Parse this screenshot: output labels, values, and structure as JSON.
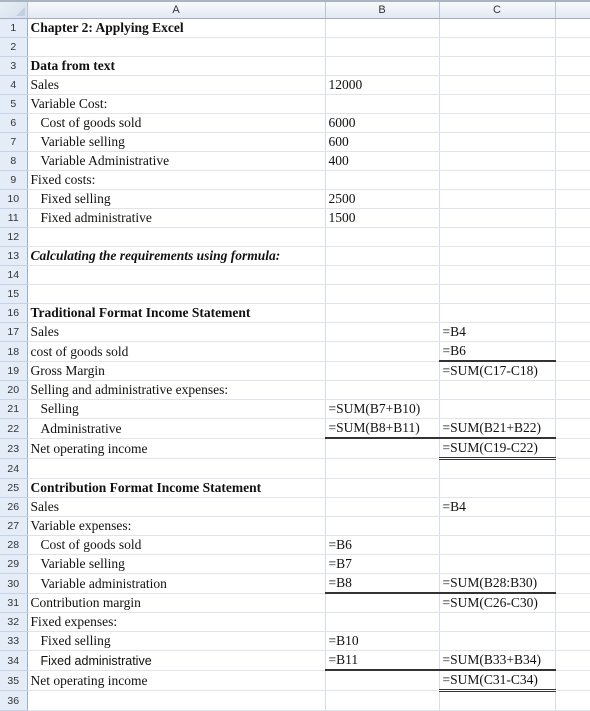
{
  "columns": [
    "A",
    "B",
    "C",
    ""
  ],
  "rows": [
    {
      "n": "1",
      "a": "Chapter 2: Applying Excel",
      "a_style": "bold",
      "b": "",
      "c": ""
    },
    {
      "n": "2",
      "a": "",
      "b": "",
      "c": ""
    },
    {
      "n": "3",
      "a": "Data from text",
      "a_style": "bold",
      "b": "",
      "c": ""
    },
    {
      "n": "4",
      "a": "Sales",
      "b": "12000",
      "c": ""
    },
    {
      "n": "5",
      "a": "Variable Cost:",
      "b": "",
      "c": ""
    },
    {
      "n": "6",
      "a": "Cost of goods sold",
      "a_style": "indent",
      "b": "6000",
      "c": ""
    },
    {
      "n": "7",
      "a": "Variable selling",
      "a_style": "indent",
      "b": "600",
      "c": ""
    },
    {
      "n": "8",
      "a": "Variable Administrative",
      "a_style": "indent",
      "b": "400",
      "c": ""
    },
    {
      "n": "9",
      "a": "Fixed costs:",
      "b": "",
      "c": ""
    },
    {
      "n": "10",
      "a": "Fixed selling",
      "a_style": "indent",
      "b": "2500",
      "c": ""
    },
    {
      "n": "11",
      "a": "Fixed administrative",
      "a_style": "indent",
      "b": "1500",
      "c": ""
    },
    {
      "n": "12",
      "a": "",
      "b": "",
      "c": ""
    },
    {
      "n": "13",
      "a": "Calculating the requirements using formula:",
      "a_style": "bolditalic",
      "b": "",
      "c": ""
    },
    {
      "n": "14",
      "a": "",
      "b": "",
      "c": ""
    },
    {
      "n": "15",
      "a": "",
      "b": "",
      "c": ""
    },
    {
      "n": "16",
      "a": "Traditional Format Income Statement",
      "a_style": "bold",
      "b": "",
      "c": ""
    },
    {
      "n": "17",
      "a": "Sales",
      "b": "",
      "c": "=B4"
    },
    {
      "n": "18",
      "a": "cost of goods sold",
      "b": "",
      "c": "=B6",
      "c_border": "single"
    },
    {
      "n": "19",
      "a": "Gross Margin",
      "b": "",
      "c": "=SUM(C17-C18)"
    },
    {
      "n": "20",
      "a": "Selling and administrative expenses:",
      "b": "",
      "c": ""
    },
    {
      "n": "21",
      "a": "Selling",
      "a_style": "indent",
      "b": "=SUM(B7+B10)",
      "c": ""
    },
    {
      "n": "22",
      "a": "Administrative",
      "a_style": "indent",
      "b": "=SUM(B8+B11)",
      "b_border": "single",
      "c": "=SUM(B21+B22)",
      "c_border": "single"
    },
    {
      "n": "23",
      "a": "Net operating income",
      "b": "",
      "c": "=SUM(C19-C22)",
      "c_border": "double"
    },
    {
      "n": "24",
      "a": "",
      "b": "",
      "c": ""
    },
    {
      "n": "25",
      "a": "Contribution Format Income Statement",
      "a_style": "bold",
      "b": "",
      "c": ""
    },
    {
      "n": "26",
      "a": "Sales",
      "b": "",
      "c": "=B4"
    },
    {
      "n": "27",
      "a": "Variable expenses:",
      "b": "",
      "c": ""
    },
    {
      "n": "28",
      "a": "Cost of goods sold",
      "a_style": "indent",
      "b": "=B6",
      "c": ""
    },
    {
      "n": "29",
      "a": "Variable selling",
      "a_style": "indent",
      "b": "=B7",
      "c": ""
    },
    {
      "n": "30",
      "a": "Variable administration",
      "a_style": "indent",
      "b": "=B8",
      "b_border": "single",
      "c": "=SUM(B28:B30)",
      "c_border": "single"
    },
    {
      "n": "31",
      "a": "Contribution margin",
      "b": "",
      "c": "=SUM(C26-C30)"
    },
    {
      "n": "32",
      "a": "Fixed expenses:",
      "b": "",
      "c": ""
    },
    {
      "n": "33",
      "a": "Fixed selling",
      "a_style": "indent",
      "b": "=B10",
      "c": ""
    },
    {
      "n": "34",
      "a": "Fixed administrative",
      "a_style": "indent",
      "b": "=B11",
      "b_border": "single",
      "c": "=SUM(B33+B34)",
      "c_border": "single"
    },
    {
      "n": "35",
      "a": "Net operating income",
      "b": "",
      "c": "=SUM(C31-C34)",
      "c_border": "double"
    },
    {
      "n": "36",
      "a": "",
      "b": "",
      "c": ""
    }
  ]
}
